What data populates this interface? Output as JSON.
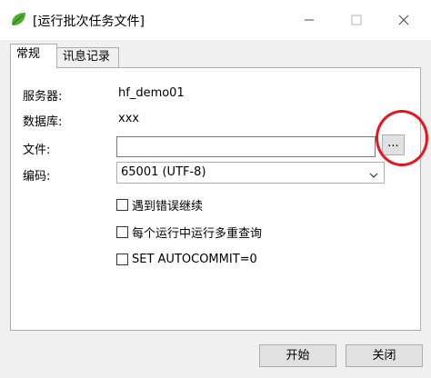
{
  "window": {
    "title": "[运行批次任务文件]",
    "icons": {
      "app": "leaf-app-icon",
      "minimize": "minimize-icon",
      "maximize": "maximize-icon",
      "close": "close-icon"
    }
  },
  "tabs": [
    {
      "label": "常规",
      "selected": true
    },
    {
      "label": "讯息记录",
      "selected": false
    }
  ],
  "form": {
    "server_label": "服务器:",
    "server_value": "hf_demo01",
    "database_label": "数据库:",
    "database_value": "xxx",
    "file_label": "文件:",
    "file_value": "",
    "browse_label": "...",
    "encoding_label": "编码:",
    "encoding_value": "65001 (UTF-8)",
    "options": [
      {
        "label": "遇到错误继续",
        "checked": false
      },
      {
        "label": "每个运行中运行多重查询",
        "checked": false
      },
      {
        "label": "SET AUTOCOMMIT=0",
        "checked": false
      }
    ]
  },
  "buttons": {
    "start": "开始",
    "close": "关闭"
  },
  "colors": {
    "annotation": "#e8141a",
    "window_bg": "#f0f0f0"
  }
}
